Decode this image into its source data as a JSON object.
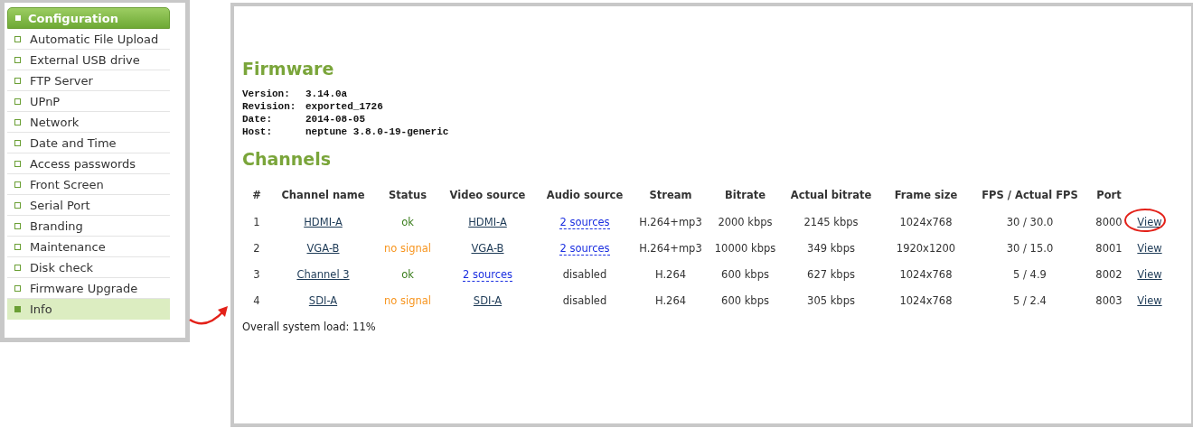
{
  "sidebar": {
    "header": "Configuration",
    "items": [
      {
        "label": "Automatic File Upload",
        "selected": false
      },
      {
        "label": "External USB drive",
        "selected": false
      },
      {
        "label": "FTP Server",
        "selected": false
      },
      {
        "label": "UPnP",
        "selected": false
      },
      {
        "label": "Network",
        "selected": false
      },
      {
        "label": "Date and Time",
        "selected": false
      },
      {
        "label": "Access passwords",
        "selected": false
      },
      {
        "label": "Front Screen",
        "selected": false
      },
      {
        "label": "Serial Port",
        "selected": false
      },
      {
        "label": "Branding",
        "selected": false
      },
      {
        "label": "Maintenance",
        "selected": false
      },
      {
        "label": "Disk check",
        "selected": false
      },
      {
        "label": "Firmware Upgrade",
        "selected": false
      },
      {
        "label": "Info",
        "selected": true
      }
    ]
  },
  "firmware": {
    "title": "Firmware",
    "fields": [
      {
        "label": "Version:",
        "value": "3.14.0a"
      },
      {
        "label": "Revision:",
        "value": "exported_1726"
      },
      {
        "label": "Date:",
        "value": "2014-08-05"
      },
      {
        "label": "Host:",
        "value": "neptune 3.8.0-19-generic"
      }
    ]
  },
  "channels": {
    "title": "Channels",
    "columns": [
      "#",
      "Channel name",
      "Status",
      "Video source",
      "Audio source",
      "Stream",
      "Bitrate",
      "Actual bitrate",
      "Frame size",
      "FPS / Actual FPS",
      "Port"
    ],
    "rows": [
      {
        "circled": true,
        "cells": [
          {
            "kind": "text",
            "text": "1"
          },
          {
            "kind": "link",
            "text": "HDMI-A"
          },
          {
            "kind": "status",
            "text": "ok",
            "color": "#3a7d1c"
          },
          {
            "kind": "link",
            "text": "HDMI-A"
          },
          {
            "kind": "sources",
            "text": "2 sources"
          },
          {
            "kind": "text",
            "text": "H.264+mp3"
          },
          {
            "kind": "text",
            "text": "2000 kbps"
          },
          {
            "kind": "text",
            "text": "2145 kbps"
          },
          {
            "kind": "text",
            "text": "1024x768"
          },
          {
            "kind": "text",
            "text": "30 / 30.0"
          },
          {
            "kind": "text",
            "text": "8000"
          },
          {
            "kind": "link",
            "text": "View"
          }
        ]
      },
      {
        "circled": false,
        "cells": [
          {
            "kind": "text",
            "text": "2"
          },
          {
            "kind": "link",
            "text": "VGA-B"
          },
          {
            "kind": "status",
            "text": "no signal",
            "color": "#f7941d"
          },
          {
            "kind": "link",
            "text": "VGA-B"
          },
          {
            "kind": "sources",
            "text": "2 sources"
          },
          {
            "kind": "text",
            "text": "H.264+mp3"
          },
          {
            "kind": "text",
            "text": "10000 kbps"
          },
          {
            "kind": "text",
            "text": "349 kbps"
          },
          {
            "kind": "text",
            "text": "1920x1200"
          },
          {
            "kind": "text",
            "text": "30 / 15.0"
          },
          {
            "kind": "text",
            "text": "8001"
          },
          {
            "kind": "link",
            "text": "View"
          }
        ]
      },
      {
        "circled": false,
        "cells": [
          {
            "kind": "text",
            "text": "3"
          },
          {
            "kind": "link",
            "text": "Channel 3"
          },
          {
            "kind": "status",
            "text": "ok",
            "color": "#3a7d1c"
          },
          {
            "kind": "sources",
            "text": "2 sources"
          },
          {
            "kind": "text",
            "text": "disabled"
          },
          {
            "kind": "text",
            "text": "H.264"
          },
          {
            "kind": "text",
            "text": "600 kbps"
          },
          {
            "kind": "text",
            "text": "627 kbps"
          },
          {
            "kind": "text",
            "text": "1024x768"
          },
          {
            "kind": "text",
            "text": "5 / 4.9"
          },
          {
            "kind": "text",
            "text": "8002"
          },
          {
            "kind": "link",
            "text": "View"
          }
        ]
      },
      {
        "circled": false,
        "cells": [
          {
            "kind": "text",
            "text": "4"
          },
          {
            "kind": "link",
            "text": "SDI-A"
          },
          {
            "kind": "status",
            "text": "no signal",
            "color": "#f7941d"
          },
          {
            "kind": "link",
            "text": "SDI-A"
          },
          {
            "kind": "text",
            "text": "disabled"
          },
          {
            "kind": "text",
            "text": "H.264"
          },
          {
            "kind": "text",
            "text": "600 kbps"
          },
          {
            "kind": "text",
            "text": "305 kbps"
          },
          {
            "kind": "text",
            "text": "1024x768"
          },
          {
            "kind": "text",
            "text": "5 / 2.4"
          },
          {
            "kind": "text",
            "text": "8003"
          },
          {
            "kind": "link",
            "text": "View"
          }
        ]
      }
    ],
    "load": "Overall system load: 11%"
  }
}
